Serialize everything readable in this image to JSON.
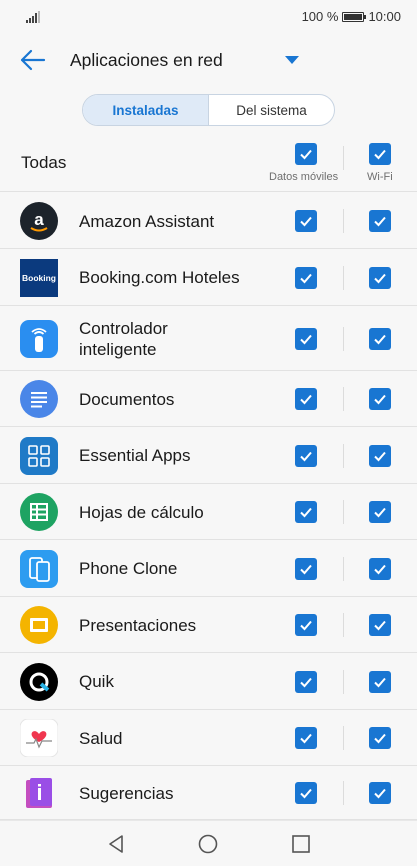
{
  "status": {
    "battery_text": "100 %",
    "time": "10:00"
  },
  "app_bar": {
    "title": "Aplicaciones en red"
  },
  "tabs": [
    {
      "label": "Instaladas",
      "active": true
    },
    {
      "label": "Del sistema",
      "active": false
    }
  ],
  "header": {
    "all_label": "Todas",
    "mobile_data_label": "Datos móviles",
    "wifi_label": "Wi-Fi"
  },
  "apps": [
    {
      "name": "Amazon Assistant",
      "icon": "amazon-icon",
      "mobile_data": true,
      "wifi": true
    },
    {
      "name": "Booking.com Hoteles",
      "icon": "booking-icon",
      "icon_text": "Booking",
      "mobile_data": true,
      "wifi": true
    },
    {
      "name": "Controlador\ninteligente",
      "icon": "smart-remote-icon",
      "mobile_data": true,
      "wifi": true
    },
    {
      "name": "Documentos",
      "icon": "docs-icon",
      "mobile_data": true,
      "wifi": true
    },
    {
      "name": "Essential Apps",
      "icon": "essential-apps-icon",
      "mobile_data": true,
      "wifi": true
    },
    {
      "name": "Hojas de cálculo",
      "icon": "sheets-icon",
      "mobile_data": true,
      "wifi": true
    },
    {
      "name": "Phone Clone",
      "icon": "phone-clone-icon",
      "mobile_data": true,
      "wifi": true
    },
    {
      "name": "Presentaciones",
      "icon": "slides-icon",
      "mobile_data": true,
      "wifi": true
    },
    {
      "name": "Quik",
      "icon": "quik-icon",
      "mobile_data": true,
      "wifi": true
    },
    {
      "name": "Salud",
      "icon": "health-icon",
      "mobile_data": true,
      "wifi": true
    },
    {
      "name": "Sugerencias",
      "icon": "tips-icon",
      "mobile_data": true,
      "wifi": true
    }
  ],
  "colors": {
    "accent": "#1976d2"
  }
}
